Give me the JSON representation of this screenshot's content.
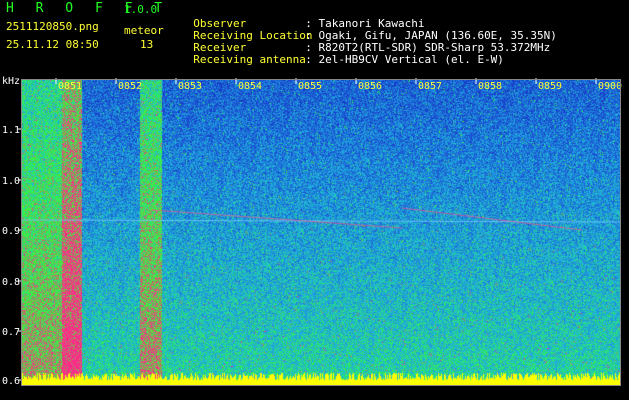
{
  "header": {
    "app_title": "H R O F F T",
    "version": "1.0.0",
    "filename": "2511120850.png",
    "meteor_label": "meteor",
    "datetime": "25.11.12 08:50",
    "meteor_count": "13"
  },
  "info": [
    {
      "label": "Observer",
      "value": "Takanori Kawachi"
    },
    {
      "label": "Receiving Location",
      "value": "Ogaki, Gifu, JAPAN (136.60E, 35.35N)"
    },
    {
      "label": "Receiver",
      "value": "R820T2(RTL-SDR) SDR-Sharp 53.372MHz"
    },
    {
      "label": "Receiving antenna",
      "value": "2el-HB9CV Vertical (el. E-W)"
    }
  ],
  "chart_data": {
    "type": "heatmap",
    "ylabel": "kHz",
    "y_ticks": [
      "1.1",
      "1.0",
      "0.9",
      "0.8",
      "0.7",
      "0.6"
    ],
    "x_ticks": [
      "0851",
      "0852",
      "0853",
      "0854",
      "0855",
      "0856",
      "0857",
      "0858",
      "0859",
      "0900"
    ],
    "colors": {
      "background": "#000000",
      "low": "#0a0f7a",
      "mid": "#1fb3e0",
      "high": "#33ff33",
      "peak": "#ff2a8a",
      "ground": "#ffff00"
    }
  }
}
